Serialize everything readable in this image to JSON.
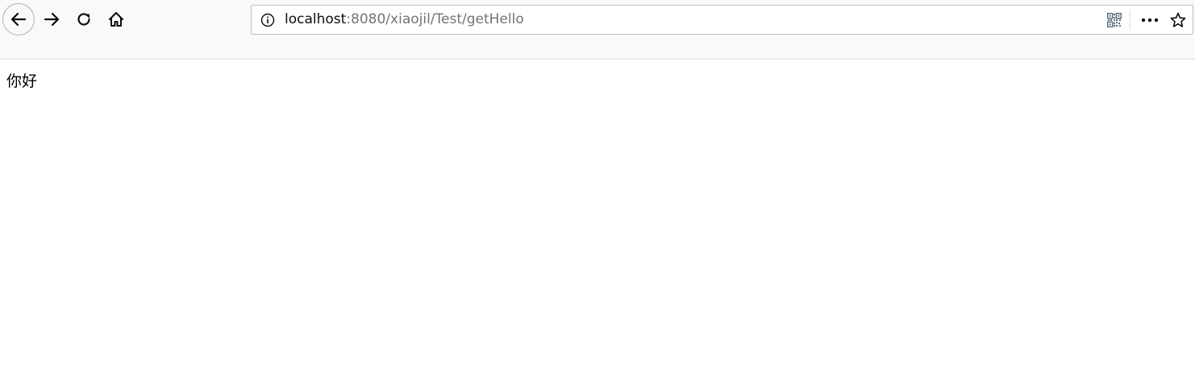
{
  "browser": {
    "url": {
      "host": "localhost",
      "rest": ":8080/xiaojil/Test/getHello"
    },
    "icons": {
      "back": "back-arrow-icon",
      "forward": "forward-arrow-icon",
      "reload": "reload-icon",
      "home": "home-icon",
      "info": "info-icon",
      "qr": "qr-code-icon",
      "more": "more-actions-icon",
      "bookmark": "bookmark-star-icon"
    },
    "colors": {
      "toolbar_bg": "#f9f9fa",
      "url_host": "#0c0c0d",
      "url_rest": "#737373"
    }
  },
  "page": {
    "body_text": "你好"
  }
}
